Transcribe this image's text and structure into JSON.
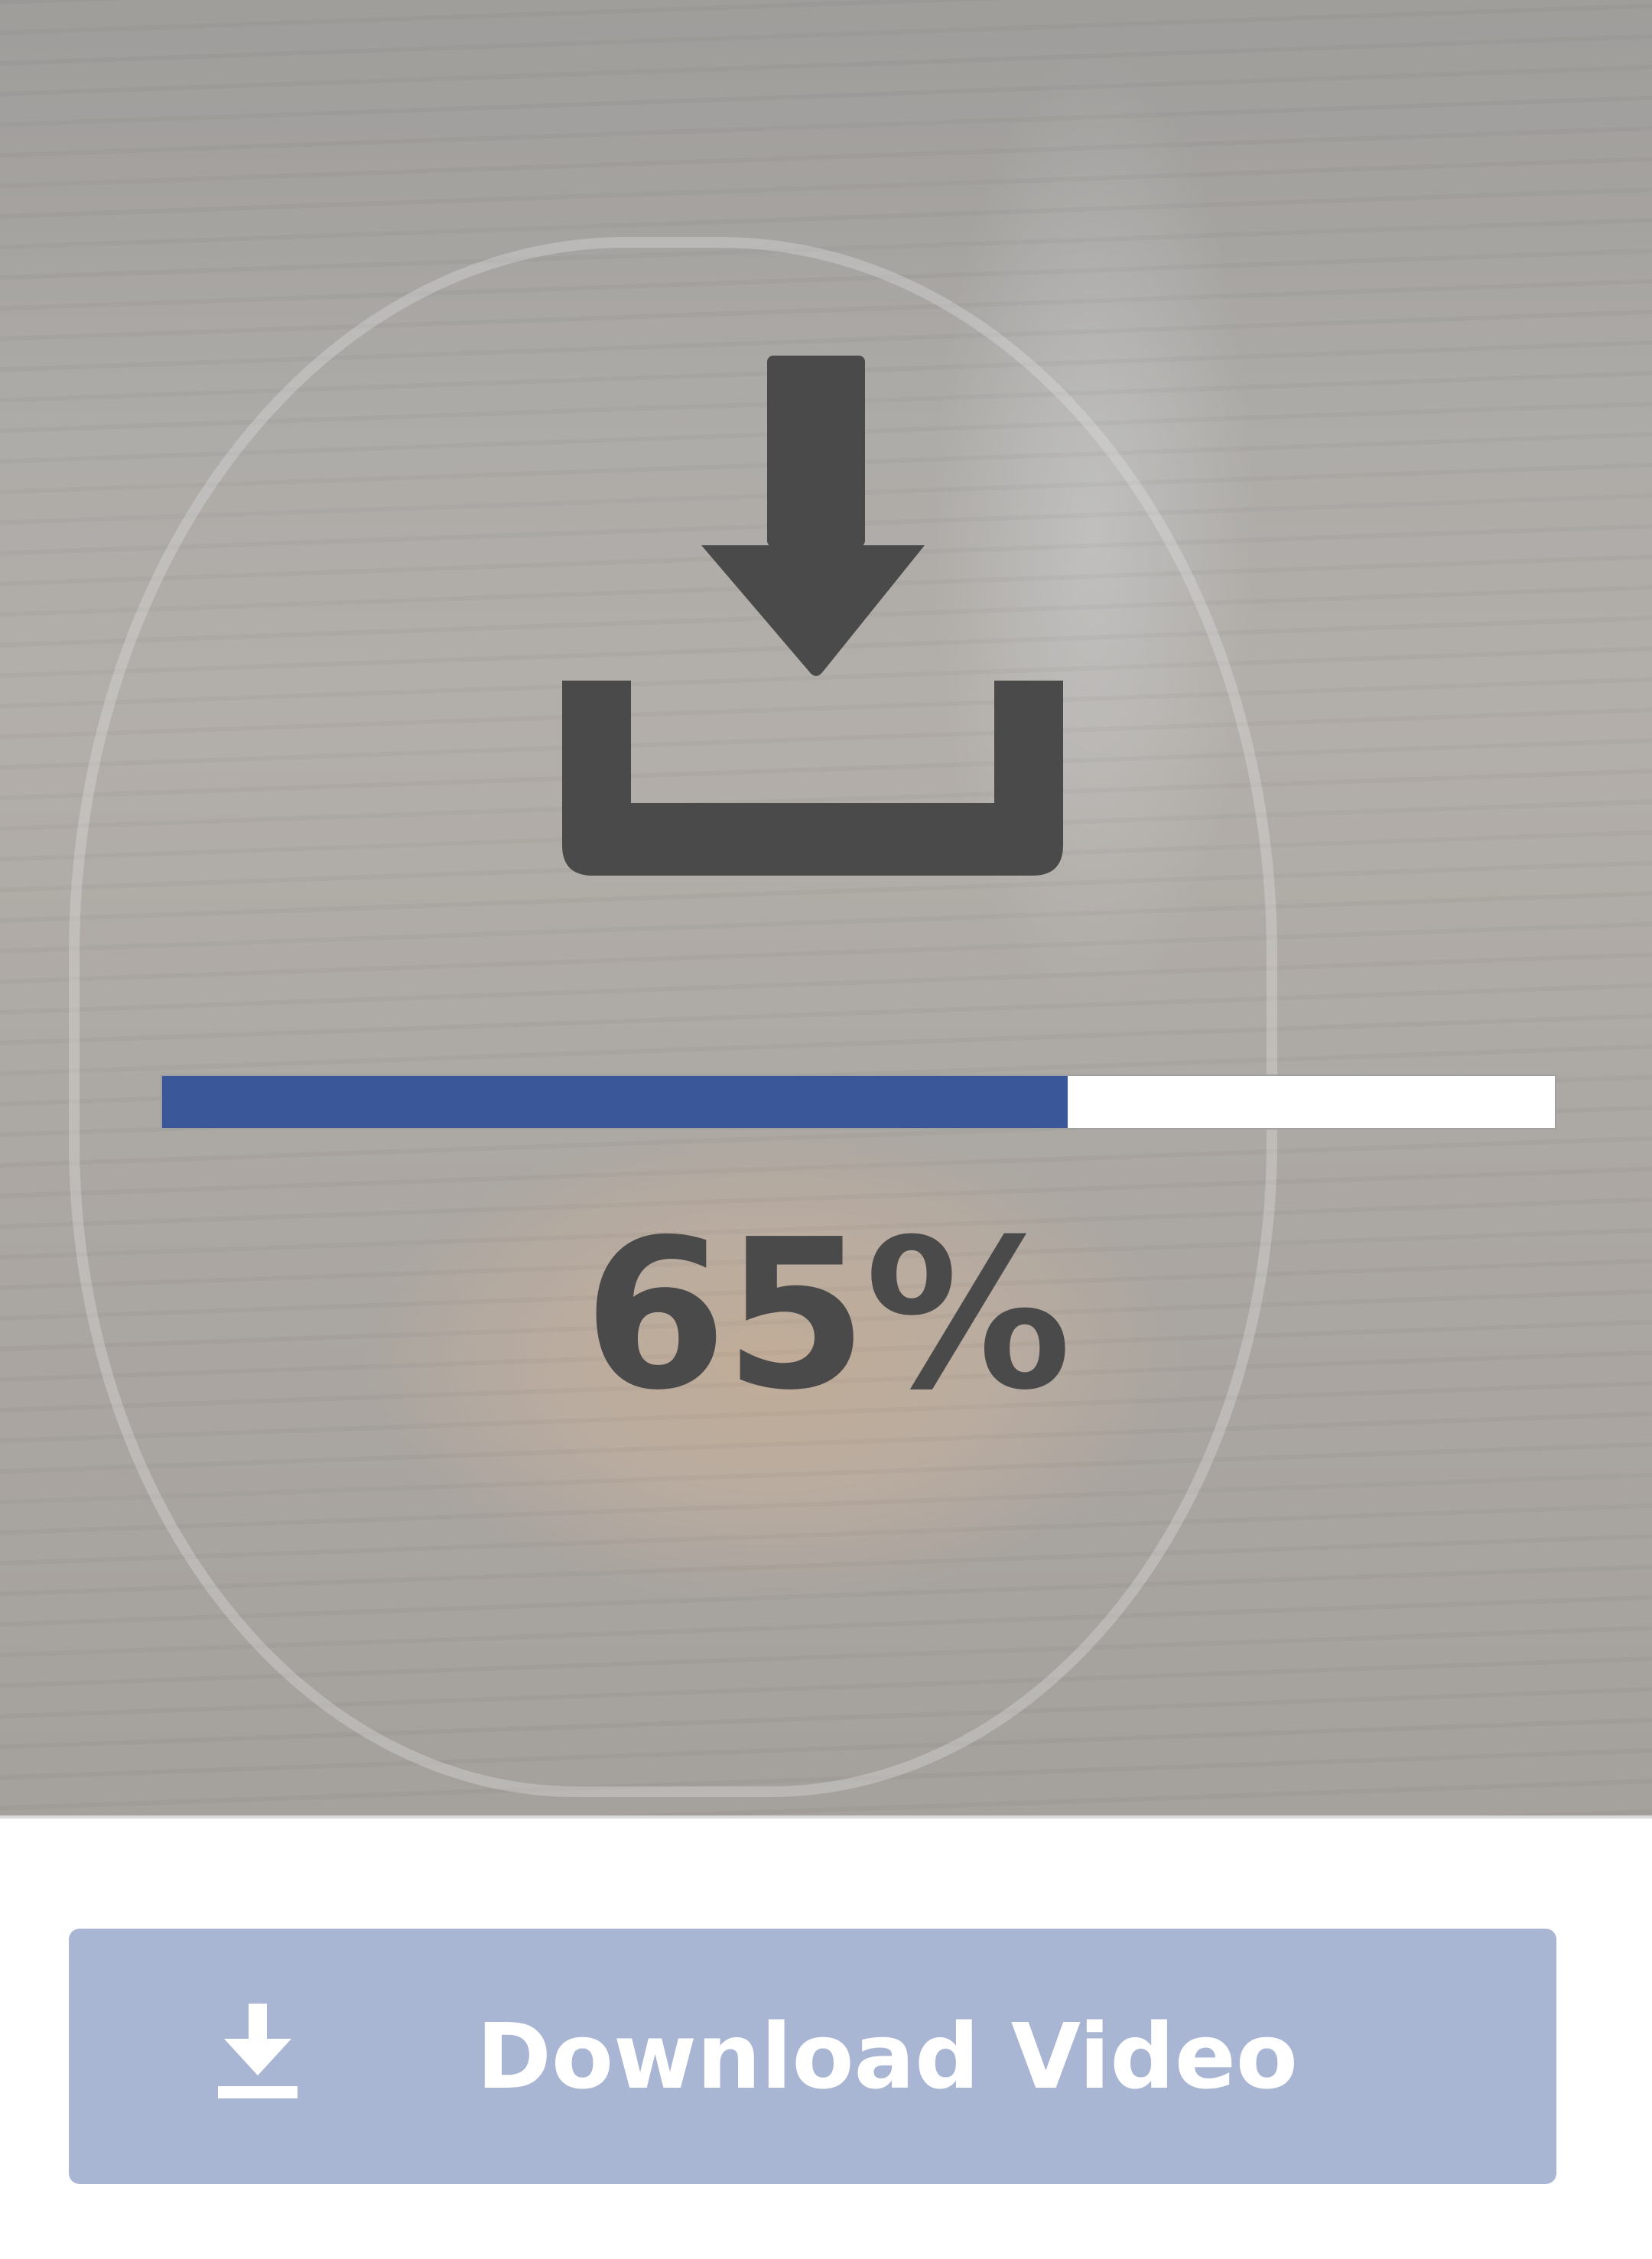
{
  "preview": {
    "icon": "download-tray-icon",
    "progress": {
      "percent": 65,
      "fill_color": "#3a579a",
      "label": "65%"
    }
  },
  "action": {
    "label": "Download Video",
    "icon": "download-icon",
    "background_color": "#a8b5d3"
  }
}
